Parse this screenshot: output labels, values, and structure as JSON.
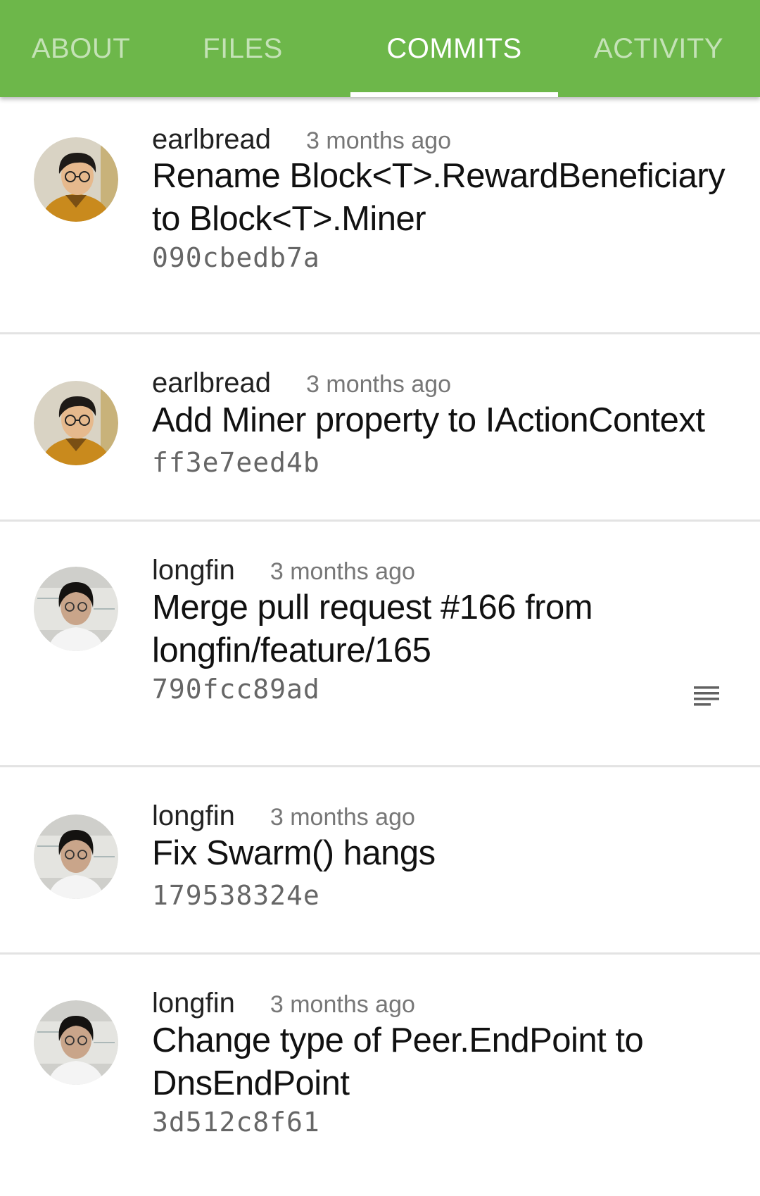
{
  "tabs": [
    {
      "label": "ABOUT",
      "active": false
    },
    {
      "label": "FILES",
      "active": false
    },
    {
      "label": "COMMITS",
      "active": true
    },
    {
      "label": "ACTIVITY",
      "active": false
    }
  ],
  "colors": {
    "tab_bar": "#6db74a",
    "divider": "#e3e3e3"
  },
  "commits": [
    {
      "author": "earlbread",
      "time": "3 months ago",
      "message": "Rename Block<T>.RewardBeneficiary to Block<T>.Miner",
      "hash": "090cbedb7a",
      "avatar": "avatar-earlbread"
    },
    {
      "author": "earlbread",
      "time": "3 months ago",
      "message": "Add Miner property to IActionContext",
      "hash": "ff3e7eed4b",
      "avatar": "avatar-earlbread"
    },
    {
      "author": "longfin",
      "time": "3 months ago",
      "message": "Merge pull request #166 from longfin/feature/165",
      "hash": "790fcc89ad",
      "avatar": "avatar-longfin",
      "has_description_icon": "notes-icon"
    },
    {
      "author": "longfin",
      "time": "3 months ago",
      "message": "Fix Swarm() hangs",
      "hash": "179538324e",
      "avatar": "avatar-longfin"
    },
    {
      "author": "longfin",
      "time": "3 months ago",
      "message": "Change type of Peer.EndPoint to DnsEndPoint",
      "hash": "3d512c8f61",
      "avatar": "avatar-longfin"
    }
  ]
}
